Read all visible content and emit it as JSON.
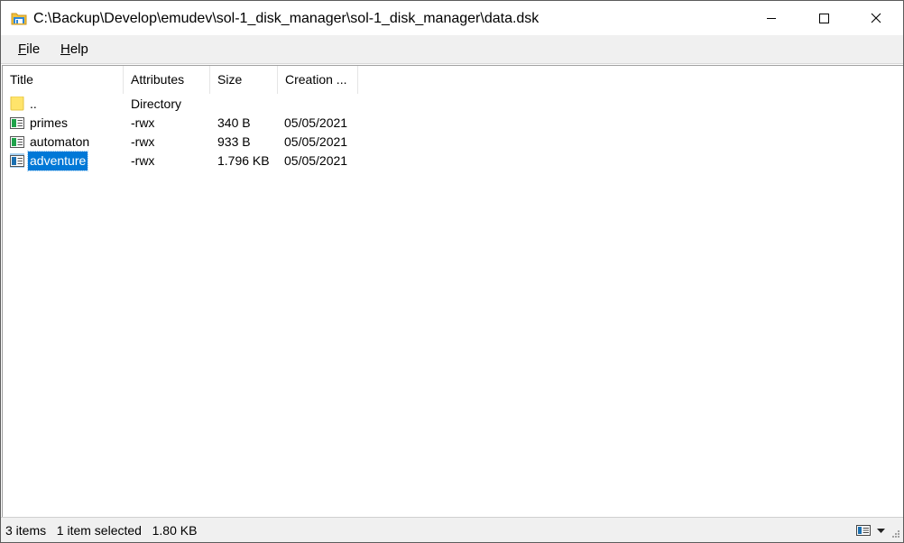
{
  "window": {
    "title": "C:\\Backup\\Develop\\emudev\\sol-1_disk_manager\\sol-1_disk_manager\\data.dsk",
    "app_icon": "folder-disk-icon",
    "controls": [
      "minimize-icon",
      "maximize-icon",
      "close-icon"
    ]
  },
  "menu": {
    "file": {
      "mnemonic": "F",
      "rest": "ile"
    },
    "help": {
      "mnemonic": "H",
      "rest": "elp"
    }
  },
  "list": {
    "columns": [
      "Title",
      "Attributes",
      "Size",
      "Creation ..."
    ],
    "rows": [
      {
        "icon": "folder-icon",
        "title": "..",
        "attributes": "Directory",
        "size": "",
        "date": ""
      },
      {
        "icon": "program-file-icon",
        "title": "primes",
        "attributes": "-rwx",
        "size": "340 B",
        "date": "05/05/2021"
      },
      {
        "icon": "program-file-icon",
        "title": "automaton",
        "attributes": "-rwx",
        "size": "933 B",
        "date": "05/05/2021"
      },
      {
        "icon": "program-file-icon",
        "title": "adventure",
        "attributes": "-rwx",
        "size": "1.796 KB",
        "date": "05/05/2021",
        "selected": true
      }
    ]
  },
  "status": {
    "text": "3 items   1 item selected   1.80 KB"
  },
  "colors": {
    "selection": "#0078d7",
    "bar_background": "#f0f0f0",
    "folder_yellow": "#ffe46b",
    "file_green": "#1fa24a"
  }
}
